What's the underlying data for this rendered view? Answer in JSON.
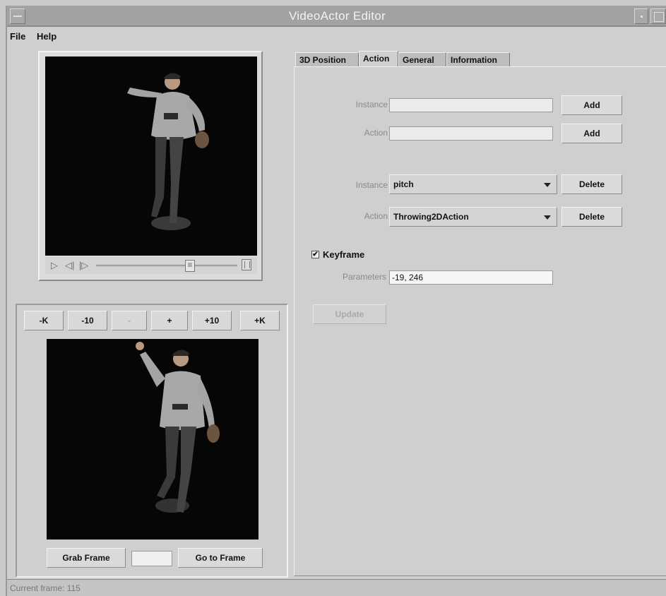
{
  "window": {
    "title": "VideoActor Editor"
  },
  "menu": {
    "file": "File",
    "help": "Help"
  },
  "player": {
    "controls": {
      "play": "play-icon",
      "step_back": "step-back-icon",
      "step_forward": "step-forward-icon"
    },
    "position": 0.68
  },
  "frame_nav": {
    "buttons": [
      "-K",
      "-10",
      "-",
      "+",
      "+10",
      "+K"
    ],
    "grab_label": "Grab Frame",
    "frame_value": "",
    "goto_label": "Go to Frame"
  },
  "tabs": [
    {
      "label": "3D Position",
      "active": false
    },
    {
      "label": "Action",
      "active": true
    },
    {
      "label": "General",
      "active": false
    },
    {
      "label": "Information",
      "active": false
    }
  ],
  "action_tab": {
    "new_instance_label": "Instance",
    "new_instance_value": "",
    "new_instance_add": "Add",
    "new_action_label": "Action",
    "new_action_value": "",
    "new_action_add": "Add",
    "instance_label": "Instance",
    "instance_selected": "pitch",
    "instance_delete": "Delete",
    "action_label": "Action",
    "action_selected": "Throwing2DAction",
    "action_delete": "Delete",
    "keyframe_label": "Keyframe",
    "keyframe_checked": true,
    "check_mark": "✔",
    "parameters_label": "Parameters",
    "parameters_value": "-19, 246",
    "update_label": "Update"
  },
  "status": {
    "text": "Current frame: 115"
  },
  "colors": {
    "background": "#cfcfcf",
    "video": "#060606"
  }
}
